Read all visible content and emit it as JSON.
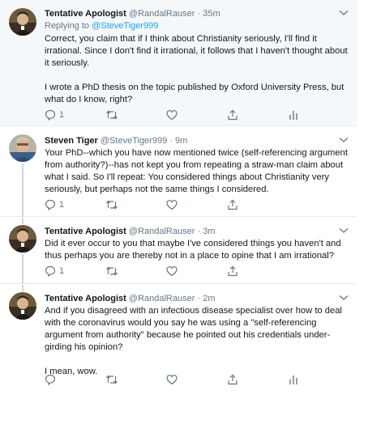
{
  "tweets": [
    {
      "name": "Tentative Apologist",
      "handle": "@RandalRauser",
      "separator": "·",
      "time": "35m",
      "replying_prefix": "Replying to",
      "replying_handle": "@SteveTiger999",
      "paragraphs": [
        "Correct, you claim that if I think about Christianity seriously, I'll find it irrational. Since I don't find it irrational, it follows that I haven't thought about it seriously.",
        "I wrote a PhD thesis on the topic published by Oxford University Press, but what do I know, right?"
      ],
      "reply_count": "1",
      "retweet_count": "",
      "like_count": ""
    },
    {
      "name": "Steven Tiger",
      "handle": "@SteveTiger999",
      "separator": "·",
      "time": "9m",
      "paragraphs": [
        "Your PhD--which you have now mentioned twice (self-referencing argument from authority?)--has not kept you from repeating a straw-man claim about what I said. So I'll repeat: You considered things about Christianity very seriously, but perhaps not the same things I considered."
      ],
      "reply_count": "1",
      "retweet_count": "",
      "like_count": ""
    },
    {
      "name": "Tentative Apologist",
      "handle": "@RandalRauser",
      "separator": "·",
      "time": "3m",
      "paragraphs": [
        "Did it ever occur to you that maybe I've considered things you haven't and thus perhaps you are thereby not in a place to opine that I am irrational?"
      ],
      "reply_count": "1",
      "retweet_count": "",
      "like_count": ""
    },
    {
      "name": "Tentative Apologist",
      "handle": "@RandalRauser",
      "separator": "·",
      "time": "2m",
      "paragraphs": [
        "And if you disagreed with an infectious disease specialist over how to deal with the coronavirus would you say he was using a \"self-referencing argument from authority\" because he pointed out his credentials under-girding his opinion?",
        "I mean, wow."
      ],
      "reply_count": "",
      "retweet_count": "",
      "like_count": ""
    }
  ],
  "icons": {
    "reply": "reply-icon",
    "retweet": "retweet-icon",
    "like": "heart-icon",
    "share": "share-icon",
    "analytics": "analytics-icon",
    "more": "chevron-down-icon"
  },
  "colors": {
    "link": "#1da1f2",
    "secondary_text": "#657786",
    "highlight_background": "#f5f8fa"
  }
}
